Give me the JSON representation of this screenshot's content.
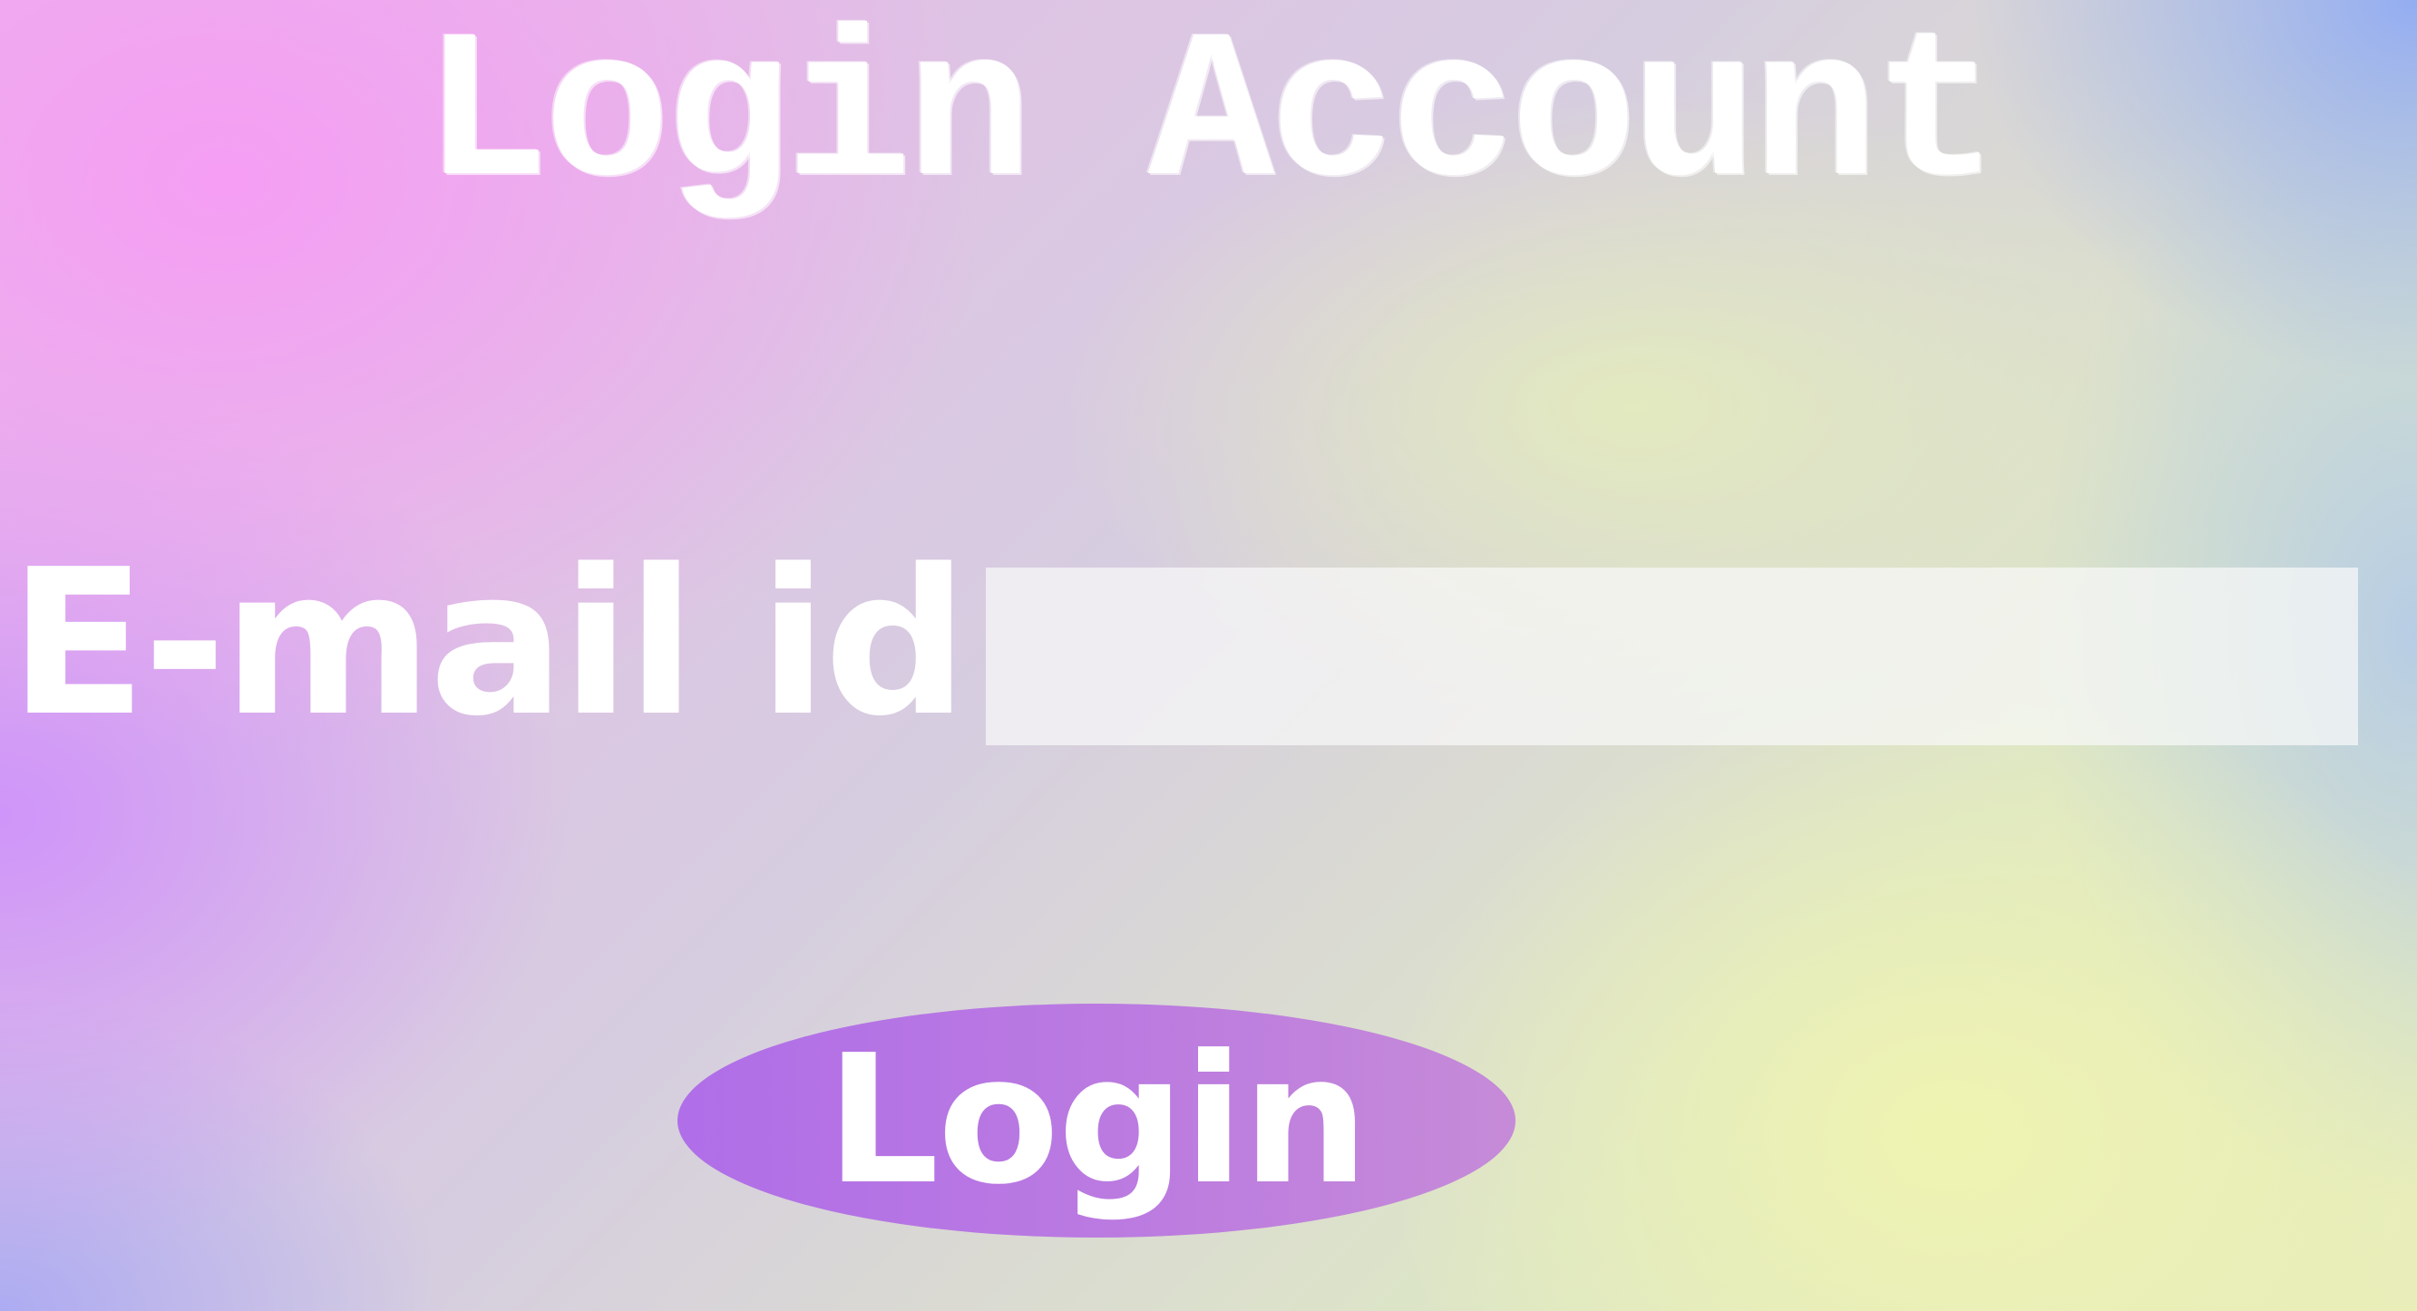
{
  "page": {
    "title": "Login Account"
  },
  "form": {
    "email_label": "E-mail id",
    "email_value": "",
    "email_placeholder": "",
    "login_button_label": "Login"
  },
  "colors": {
    "button": "#b674e4",
    "text": "#ffffff",
    "input_bg": "#f5f5f0"
  }
}
